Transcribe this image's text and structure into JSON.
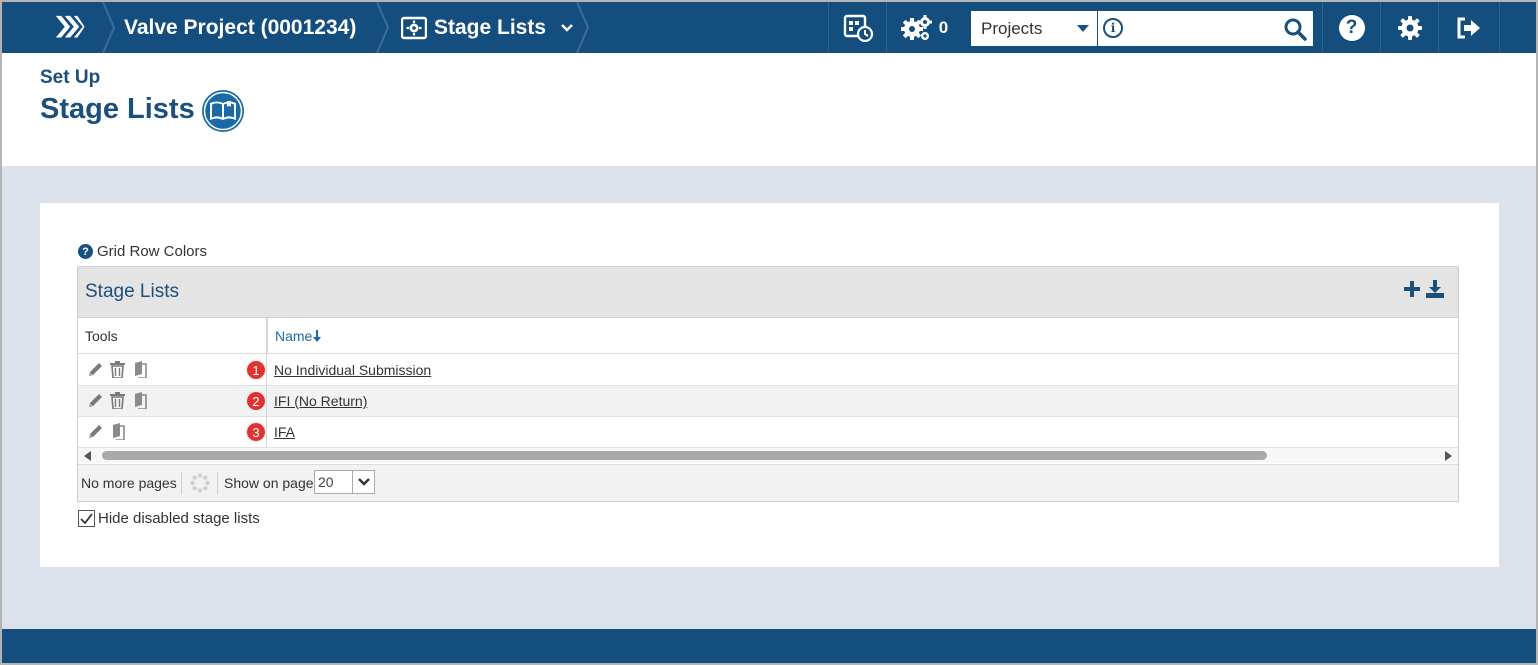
{
  "topbar": {
    "project": "Valve Project (0001234)",
    "section": "Stage Lists",
    "notifications_count": "0",
    "scope_select": "Projects",
    "search_placeholder": ""
  },
  "header": {
    "supertitle": "Set Up",
    "title": "Stage Lists"
  },
  "grid_row_colors_label": "Grid Row Colors",
  "grid": {
    "title": "Stage Lists",
    "columns": {
      "tools": "Tools",
      "name": "Name"
    },
    "rows": [
      {
        "badge": "1",
        "name": "No Individual Submission"
      },
      {
        "badge": "2",
        "name": "IFI (No Return)"
      },
      {
        "badge": "3",
        "name": "IFA"
      }
    ],
    "pager": {
      "status": "No more pages",
      "show_on_page_label": "Show on page:",
      "page_size": "20"
    }
  },
  "hide_disabled": {
    "label": "Hide disabled stage lists",
    "checked": true
  },
  "colors": {
    "brand": "#144e7e",
    "badge": "#e0322e",
    "accent_link": "#1a6aa6"
  }
}
